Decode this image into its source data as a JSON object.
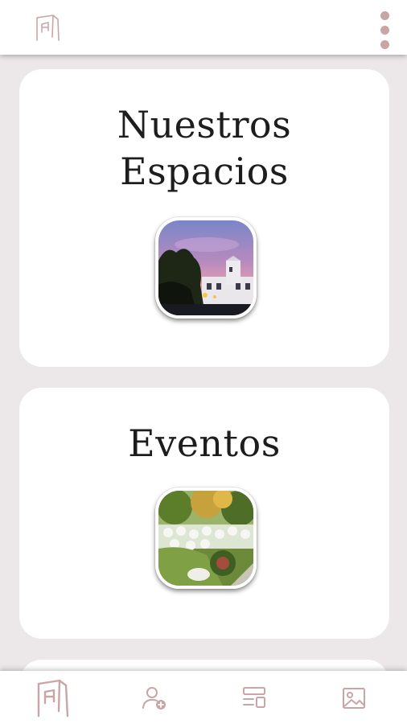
{
  "app": {
    "brand_icon": "monogram-logo",
    "menu_icon": "more-vertical-icon",
    "accent_color": "#C9A6A6"
  },
  "cards": [
    {
      "title": "Nuestros\nEspacios",
      "image_icon": "venue-photo"
    },
    {
      "title": "Eventos",
      "image_icon": "event-photo"
    }
  ],
  "bottom_nav": [
    {
      "icon": "home-logo-icon",
      "active": true
    },
    {
      "icon": "add-user-icon",
      "active": false
    },
    {
      "icon": "layout-icon",
      "active": false
    },
    {
      "icon": "image-icon",
      "active": false
    }
  ]
}
